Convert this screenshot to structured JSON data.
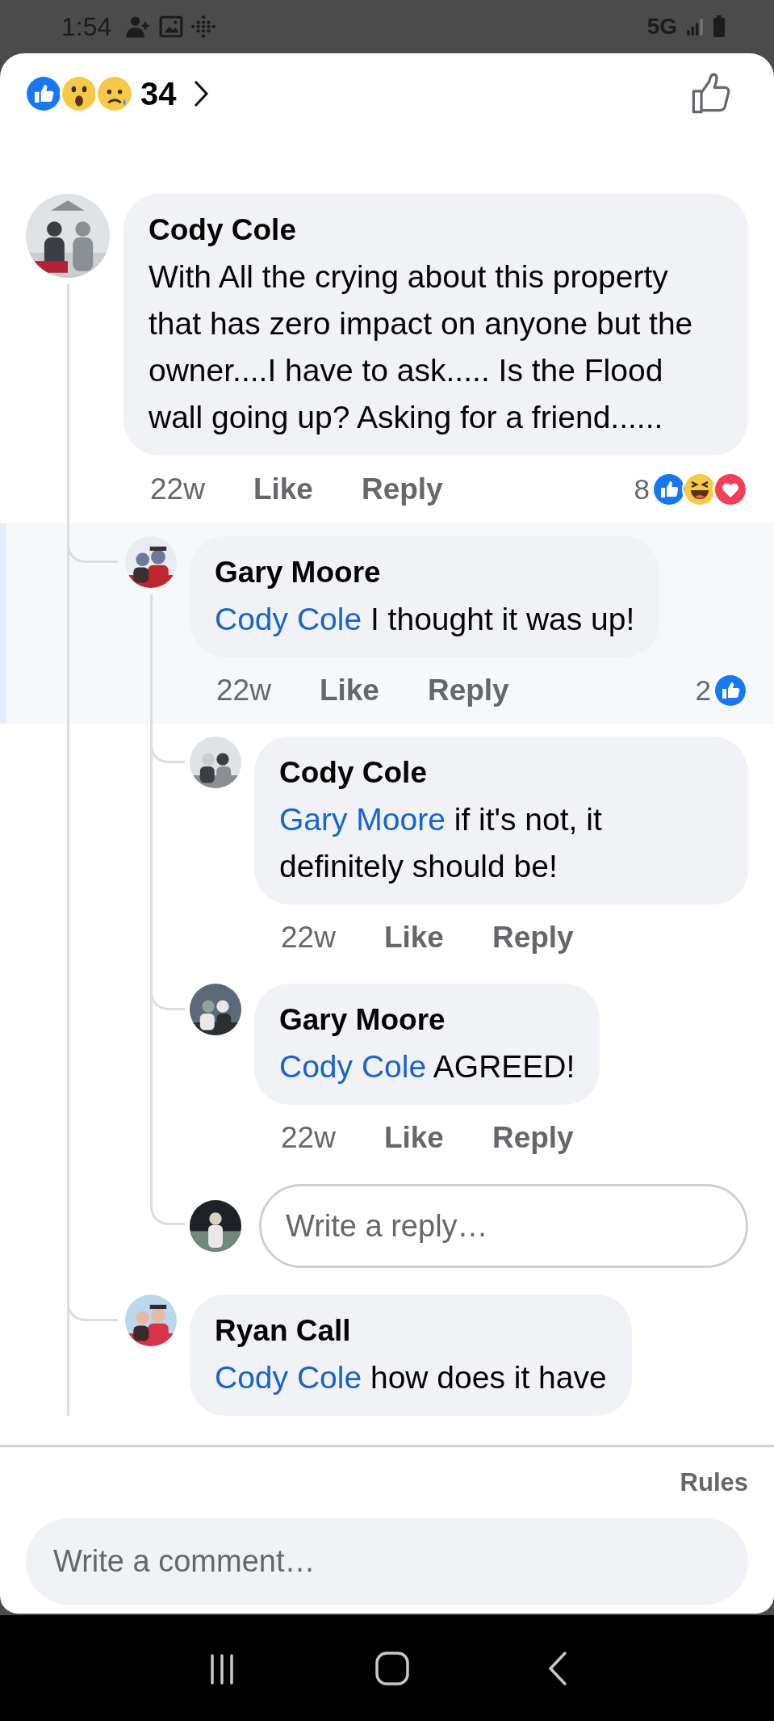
{
  "status_bar": {
    "time": "1:54",
    "network": "5G"
  },
  "header": {
    "reactions": [
      {
        "kind": "like"
      },
      {
        "kind": "wow"
      },
      {
        "kind": "sad"
      }
    ],
    "count": "34"
  },
  "comments": [
    {
      "author": "Cody Cole",
      "text": "With All the crying about this property that has zero impact on anyone but the owner....I have to ask..... Is the Flood wall going up? Asking for a friend......",
      "time": "22w",
      "like": "Like",
      "reply": "Reply",
      "reaction_count": "8",
      "reactions": [
        {
          "kind": "like"
        },
        {
          "kind": "haha"
        },
        {
          "kind": "love"
        }
      ],
      "children": [
        {
          "author": "Gary Moore",
          "mention": "Cody Cole",
          "text": "I thought it was up!",
          "time": "22w",
          "like": "Like",
          "reply": "Reply",
          "reaction_count": "2",
          "reactions": [
            {
              "kind": "like"
            }
          ],
          "highlighted": true,
          "children": [
            {
              "author": "Cody Cole",
              "mention": "Gary Moore",
              "text": "if it's not, it definitely should be!",
              "time": "22w",
              "like": "Like",
              "reply": "Reply"
            },
            {
              "author": "Gary Moore",
              "mention": "Cody Cole",
              "text": "AGREED!",
              "time": "22w",
              "like": "Like",
              "reply": "Reply"
            }
          ],
          "reply_field": {
            "placeholder": "Write a reply…"
          }
        },
        {
          "author": "Ryan Call",
          "mention": "Cody Cole",
          "text": "how does it have"
        }
      ]
    }
  ],
  "footer": {
    "rules": "Rules",
    "comment_field": {
      "placeholder": "Write a comment…"
    }
  }
}
